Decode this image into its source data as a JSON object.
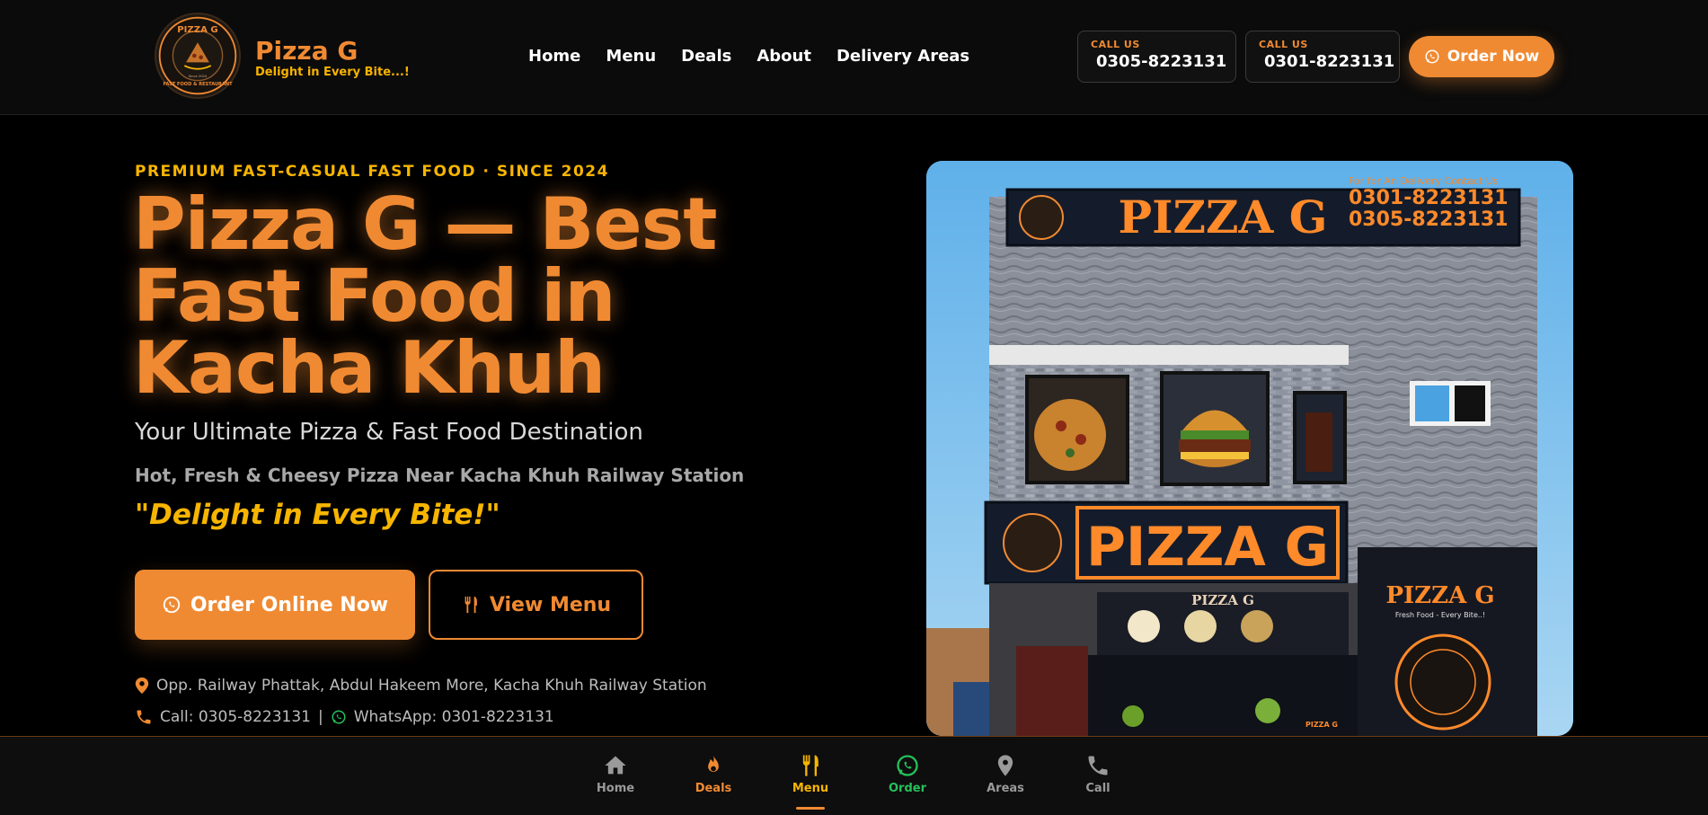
{
  "header": {
    "logo": {
      "arc_text": "PIZZA G",
      "ring_text": "FAST FOOD & RESTAURANT",
      "since": "Since 2024"
    },
    "brand_name": "Pizza G",
    "brand_tagline": "Delight in Every Bite...!",
    "nav": [
      "Home",
      "Menu",
      "Deals",
      "About",
      "Delivery Areas"
    ],
    "calls": [
      {
        "label": "CALL US",
        "number": "0305-8223131"
      },
      {
        "label": "CALL US",
        "number": "0301-8223131"
      }
    ],
    "order_button": "Order Now"
  },
  "hero": {
    "eyebrow": "PREMIUM FAST-CASUAL FAST FOOD · SINCE 2024",
    "title": "Pizza G — Best Fast Food in Kacha Khuh",
    "subtitle": "Your Ultimate Pizza & Fast Food Destination",
    "subline": "Hot, Fresh & Cheesy Pizza Near Kacha Khuh Railway Station",
    "slogan": "\"Delight in Every Bite!\"",
    "cta_primary": "Order Online Now",
    "cta_secondary": "View Menu",
    "address": "Opp. Railway Phattak, Abdul Hakeem More, Kacha Khuh Railway Station",
    "call_text": "Call: 0305-8223131",
    "separator": "|",
    "whatsapp_text": "WhatsApp: 0301-8223131"
  },
  "storefront": {
    "sign_top": "PIZZA G",
    "sign_contact_label": "For for An Delivery Contact Us",
    "sign_phone_1": "0301-8223131",
    "sign_phone_2": "0305-8223131",
    "sign_middle": "PIZZA G",
    "sign_door": "PIZZA G",
    "sign_door_sub": "Fresh Food - Every Bite..!",
    "sign_banner": "PIZZA G",
    "small_plate": "PIZZA G"
  },
  "bottom_nav": [
    {
      "label": "Home",
      "icon": "home-icon",
      "color": "#9a9a9a"
    },
    {
      "label": "Deals",
      "icon": "fire-icon",
      "color": "#f08a32"
    },
    {
      "label": "Menu",
      "icon": "utensils-icon",
      "color": "#f7b500",
      "active": true
    },
    {
      "label": "Order",
      "icon": "whatsapp-icon",
      "color": "#25c15a"
    },
    {
      "label": "Areas",
      "icon": "map-pin-icon",
      "color": "#9a9a9a"
    },
    {
      "label": "Call",
      "icon": "phone-icon",
      "color": "#9a9a9a"
    }
  ],
  "colors": {
    "accent": "#f08a32",
    "gold": "#f7b500",
    "whatsapp": "#25c15a",
    "background": "#000000"
  }
}
